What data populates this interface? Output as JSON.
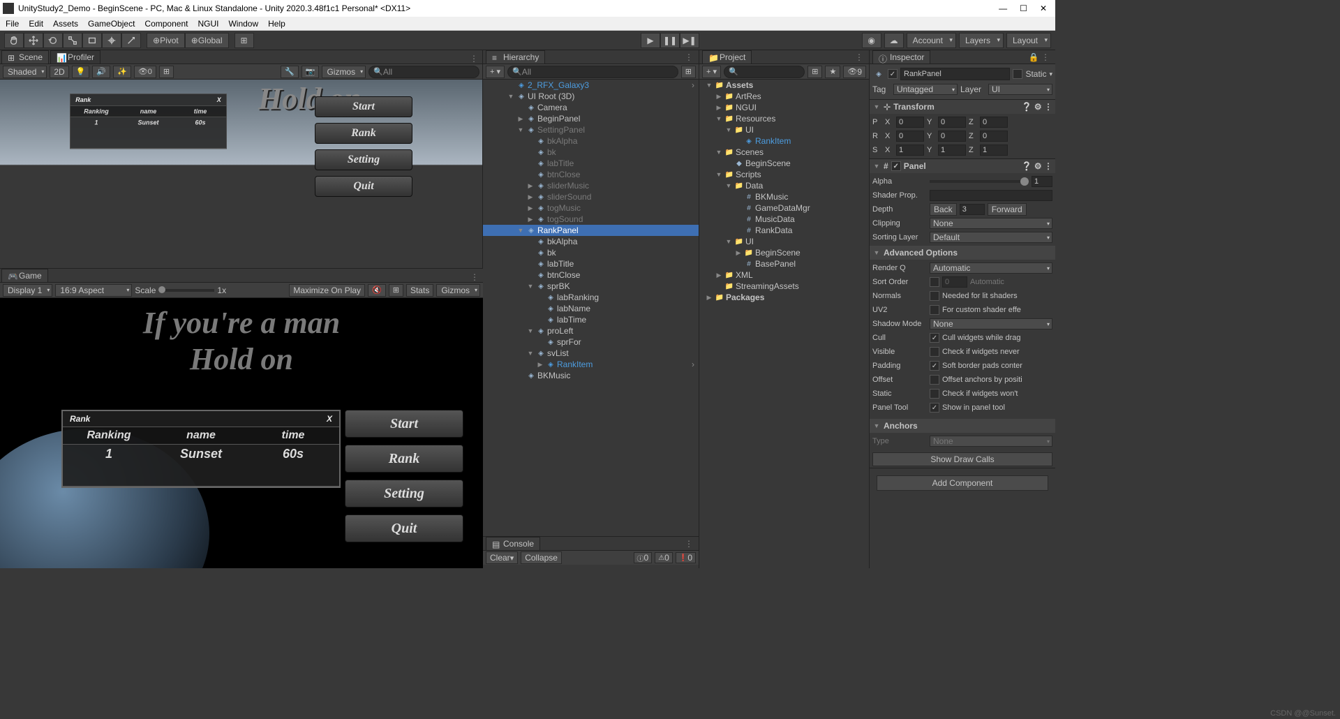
{
  "window": {
    "title": "UnityStudy2_Demo - BeginScene - PC, Mac & Linux Standalone - Unity 2020.3.48f1c1 Personal* <DX11>"
  },
  "menu": [
    "File",
    "Edit",
    "Assets",
    "GameObject",
    "Component",
    "NGUI",
    "Window",
    "Help"
  ],
  "toolbar": {
    "pivot": "Pivot",
    "global": "Global",
    "account": "Account",
    "layers": "Layers",
    "layout": "Layout"
  },
  "scene": {
    "tab_scene": "Scene",
    "tab_profiler": "Profiler",
    "shaded": "Shaded",
    "mode_2d": "2D",
    "gizmos": "Gizmos",
    "search_placeholder": "All",
    "hold_on": "Hold on"
  },
  "game": {
    "tab": "Game",
    "display": "Display 1",
    "aspect": "16:9 Aspect",
    "scale": "Scale",
    "scale_val": "1x",
    "max_on_play": "Maximize On Play",
    "stats": "Stats",
    "gizmos": "Gizmos",
    "text1": "If you're a man",
    "text2": "Hold on",
    "menu_buttons": [
      "Start",
      "Rank",
      "Setting",
      "Quit"
    ],
    "rank": {
      "title": "Rank",
      "close": "X",
      "cols": [
        "Ranking",
        "name",
        "time"
      ],
      "row": [
        "1",
        "Sunset",
        "60s"
      ]
    }
  },
  "hierarchy": {
    "tab": "Hierarchy",
    "search_placeholder": "All",
    "items": [
      {
        "d": 1,
        "fold": "",
        "icon": "prefab",
        "name": "2_RFX_Galaxy3",
        "link": true
      },
      {
        "d": 1,
        "fold": "▼",
        "icon": "cube",
        "name": "UI Root (3D)"
      },
      {
        "d": 2,
        "fold": "",
        "icon": "cube",
        "name": "Camera"
      },
      {
        "d": 2,
        "fold": "▶",
        "icon": "cube",
        "name": "BeginPanel"
      },
      {
        "d": 2,
        "fold": "▼",
        "icon": "cube",
        "name": "SettingPanel",
        "dim": true
      },
      {
        "d": 3,
        "fold": "",
        "icon": "cube",
        "name": "bkAlpha",
        "dim": true
      },
      {
        "d": 3,
        "fold": "",
        "icon": "cube",
        "name": "bk",
        "dim": true
      },
      {
        "d": 3,
        "fold": "",
        "icon": "cube",
        "name": "labTitle",
        "dim": true
      },
      {
        "d": 3,
        "fold": "",
        "icon": "cube",
        "name": "btnClose",
        "dim": true
      },
      {
        "d": 3,
        "fold": "▶",
        "icon": "cube",
        "name": "sliderMusic",
        "dim": true
      },
      {
        "d": 3,
        "fold": "▶",
        "icon": "cube",
        "name": "sliderSound",
        "dim": true
      },
      {
        "d": 3,
        "fold": "▶",
        "icon": "cube",
        "name": "togMusic",
        "dim": true
      },
      {
        "d": 3,
        "fold": "▶",
        "icon": "cube",
        "name": "togSound",
        "dim": true
      },
      {
        "d": 2,
        "fold": "▼",
        "icon": "cube",
        "name": "RankPanel",
        "selected": true
      },
      {
        "d": 3,
        "fold": "",
        "icon": "cube",
        "name": "bkAlpha"
      },
      {
        "d": 3,
        "fold": "",
        "icon": "cube",
        "name": "bk"
      },
      {
        "d": 3,
        "fold": "",
        "icon": "cube",
        "name": "labTitle"
      },
      {
        "d": 3,
        "fold": "",
        "icon": "cube",
        "name": "btnClose"
      },
      {
        "d": 3,
        "fold": "▼",
        "icon": "cube",
        "name": "sprBK"
      },
      {
        "d": 4,
        "fold": "",
        "icon": "cube",
        "name": "labRanking"
      },
      {
        "d": 4,
        "fold": "",
        "icon": "cube",
        "name": "labName"
      },
      {
        "d": 4,
        "fold": "",
        "icon": "cube",
        "name": "labTime"
      },
      {
        "d": 3,
        "fold": "▼",
        "icon": "cube",
        "name": "proLeft"
      },
      {
        "d": 4,
        "fold": "",
        "icon": "cube",
        "name": "sprFor"
      },
      {
        "d": 3,
        "fold": "▼",
        "icon": "cube",
        "name": "svList"
      },
      {
        "d": 4,
        "fold": "▶",
        "icon": "prefab",
        "name": "RankItem",
        "link": true
      },
      {
        "d": 2,
        "fold": "",
        "icon": "cube",
        "name": "BKMusic"
      }
    ]
  },
  "console": {
    "tab": "Console",
    "clear": "Clear",
    "collapse": "Collapse",
    "counts": [
      "0",
      "0",
      "0"
    ]
  },
  "project": {
    "tab": "Project",
    "vis_count": "9",
    "items": [
      {
        "d": 0,
        "fold": "▼",
        "icon": "folder",
        "name": "Assets",
        "bold": true
      },
      {
        "d": 1,
        "fold": "▶",
        "icon": "folder",
        "name": "ArtRes"
      },
      {
        "d": 1,
        "fold": "▶",
        "icon": "folder",
        "name": "NGUI"
      },
      {
        "d": 1,
        "fold": "▼",
        "icon": "folder",
        "name": "Resources"
      },
      {
        "d": 2,
        "fold": "▼",
        "icon": "folder",
        "name": "UI"
      },
      {
        "d": 3,
        "fold": "",
        "icon": "prefab",
        "name": "RankItem"
      },
      {
        "d": 1,
        "fold": "▼",
        "icon": "folder",
        "name": "Scenes"
      },
      {
        "d": 2,
        "fold": "",
        "icon": "scene",
        "name": "BeginScene"
      },
      {
        "d": 1,
        "fold": "▼",
        "icon": "folder",
        "name": "Scripts"
      },
      {
        "d": 2,
        "fold": "▼",
        "icon": "folder",
        "name": "Data"
      },
      {
        "d": 3,
        "fold": "",
        "icon": "cs",
        "name": "BKMusic"
      },
      {
        "d": 3,
        "fold": "",
        "icon": "cs",
        "name": "GameDataMgr"
      },
      {
        "d": 3,
        "fold": "",
        "icon": "cs",
        "name": "MusicData"
      },
      {
        "d": 3,
        "fold": "",
        "icon": "cs",
        "name": "RankData"
      },
      {
        "d": 2,
        "fold": "▼",
        "icon": "folder",
        "name": "UI"
      },
      {
        "d": 3,
        "fold": "▶",
        "icon": "folder",
        "name": "BeginScene"
      },
      {
        "d": 3,
        "fold": "",
        "icon": "cs",
        "name": "BasePanel"
      },
      {
        "d": 1,
        "fold": "▶",
        "icon": "folder",
        "name": "XML"
      },
      {
        "d": 1,
        "fold": "",
        "icon": "folder",
        "name": "StreamingAssets"
      },
      {
        "d": 0,
        "fold": "▶",
        "icon": "folder",
        "name": "Packages",
        "bold": true
      }
    ]
  },
  "inspector": {
    "tab": "Inspector",
    "obj_name": "RankPanel",
    "static": "Static",
    "tag_lbl": "Tag",
    "tag_val": "Untagged",
    "layer_lbl": "Layer",
    "layer_val": "UI",
    "transform": {
      "title": "Transform",
      "pos": {
        "lbl": "P",
        "x": "0",
        "y": "0",
        "z": "0"
      },
      "rot": {
        "lbl": "R",
        "x": "0",
        "y": "0",
        "z": "0"
      },
      "scl": {
        "lbl": "S",
        "x": "1",
        "y": "1",
        "z": "1"
      }
    },
    "panel": {
      "title": "Panel",
      "alpha_lbl": "Alpha",
      "alpha_val": "1",
      "shader_lbl": "Shader Prop.",
      "depth_lbl": "Depth",
      "depth_back": "Back",
      "depth_val": "3",
      "depth_fwd": "Forward",
      "clipping_lbl": "Clipping",
      "clipping_val": "None",
      "sorting_lbl": "Sorting Layer",
      "sorting_val": "Default",
      "adv_title": "Advanced Options",
      "renderq_lbl": "Render Q",
      "renderq_val": "Automatic",
      "sort_lbl": "Sort Order",
      "sort_val": "0",
      "sort_hint": "Automatic",
      "normals_lbl": "Normals",
      "normals_hint": "Needed for lit shaders",
      "uv2_lbl": "UV2",
      "uv2_hint": "For custom shader effe",
      "shadow_lbl": "Shadow Mode",
      "shadow_val": "None",
      "cull_lbl": "Cull",
      "cull_hint": "Cull widgets while drag",
      "visible_lbl": "Visible",
      "visible_hint": "Check if widgets never",
      "padding_lbl": "Padding",
      "padding_hint": "Soft border pads conter",
      "offset_lbl": "Offset",
      "offset_hint": "Offset anchors by positi",
      "static_lbl": "Static",
      "static_hint": "Check if widgets won't",
      "tool_lbl": "Panel Tool",
      "tool_hint": "Show in panel tool",
      "anchors_title": "Anchors",
      "type_lbl": "Type",
      "type_val": "None",
      "draw_calls": "Show Draw Calls"
    },
    "add_comp": "Add Component"
  },
  "watermark": "CSDN @@Sunset."
}
